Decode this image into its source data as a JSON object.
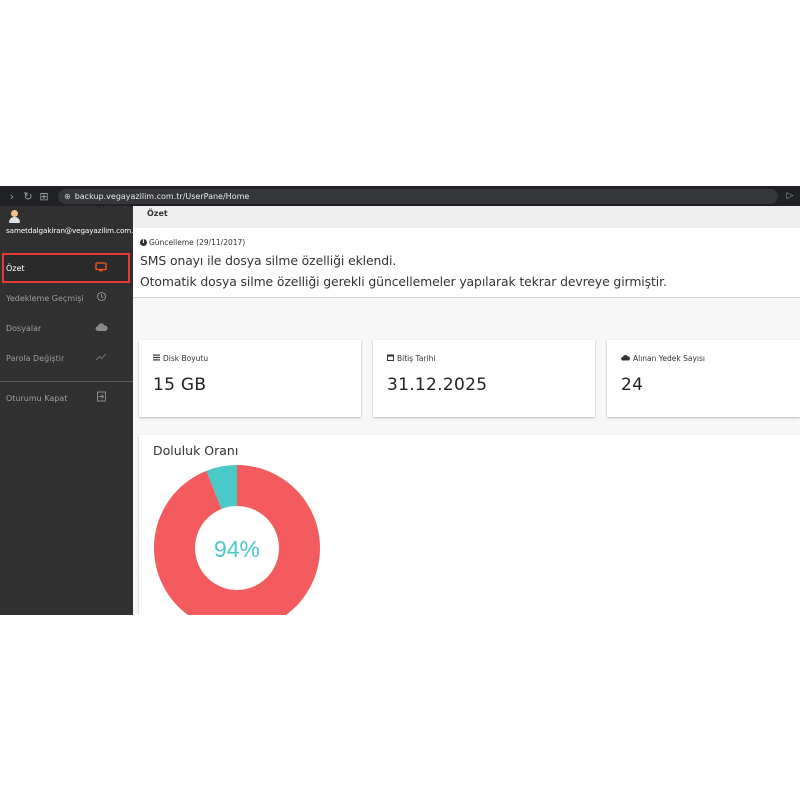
{
  "browser": {
    "url": "backup.vegayazilim.com.tr/UserPane/Home"
  },
  "sidebar": {
    "email": "sametdalgakiran@vegayazilim.com.tr",
    "items": [
      {
        "label": "Özet",
        "icon": "monitor-icon",
        "active": true
      },
      {
        "label": "Yedekleme Geçmişi",
        "icon": "history-icon",
        "active": false
      },
      {
        "label": "Dosyalar",
        "icon": "cloud-upload-icon",
        "active": false
      },
      {
        "label": "Parola Değiştir",
        "icon": "trend-icon",
        "active": false
      }
    ],
    "logout": {
      "label": "Oturumu Kapat",
      "icon": "sign-out-icon"
    }
  },
  "header": {
    "title": "Özet"
  },
  "update": {
    "title": "Güncelleme (29/11/2017)",
    "lines": [
      "SMS onayı ile dosya silme özelliği eklendi.",
      "Otomatik dosya silme özelliği gerekli güncellemeler yapılarak tekrar devreye girmiştir."
    ]
  },
  "stats": [
    {
      "label": "Disk Boyutu",
      "value": "15 GB",
      "icon": "list-icon"
    },
    {
      "label": "Bitiş Tarihi",
      "value": "31.12.2025",
      "icon": "calendar-icon"
    },
    {
      "label": "Alınan Yedek Sayısı",
      "value": "24",
      "icon": "cloud-icon"
    }
  ],
  "fill": {
    "title": "Doluluk Oranı",
    "percent_label": "94%",
    "percent": 94,
    "colors": {
      "used": "#f45b5f",
      "free": "#4bc8c8",
      "text": "#4bc8c8"
    }
  }
}
